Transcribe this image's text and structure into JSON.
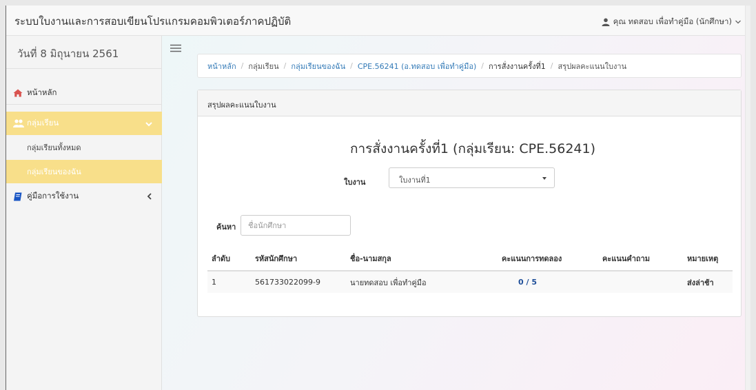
{
  "header": {
    "title": "ระบบใบงานและการสอบเขียนโปรแกรมคอมพิวเตอร์ภาคปฏิบัติ",
    "user": "คุณ ทดสอบ เพื่อทำคู่มือ (นักศึกษา)",
    "user_icon": "user-icon",
    "dropdown_icon": "caret-down-icon"
  },
  "sidebar": {
    "date": "วันที่ 8 มิถุนายน 2561",
    "items": [
      {
        "label": "หน้าหลัก",
        "icon": "home-icon"
      },
      {
        "label": "กลุ่มเรียน",
        "icon": "users-icon"
      },
      {
        "label": "กลุ่มเรียนทั้งหมด"
      },
      {
        "label": "กลุ่มเรียนของฉัน"
      },
      {
        "label": "คู่มือการใช้งาน",
        "icon": "book-icon"
      }
    ]
  },
  "breadcrumb": {
    "items": [
      "หน้าหลัก",
      "กลุ่มเรียน",
      "กลุ่มเรียนของฉัน",
      "CPE.56241 (อ.ทดสอบ เพื่อทำคู่มือ)",
      "การสั่งงานครั้งที่1",
      "สรุปผลคะแนนใบงาน"
    ]
  },
  "panel": {
    "heading": "สรุปผลคะแนนใบงาน",
    "title": "การสั่งงานครั้งที่1 (กลุ่มเรียน: CPE.56241)",
    "sheet_label": "ใบงาน",
    "sheet_selected": "ใบงานที่1",
    "search_label": "ค้นหา",
    "search_placeholder": "ชื่อนักศึกษา"
  },
  "table": {
    "headers": [
      "ลำดับ",
      "รหัสนักศึกษา",
      "ชื่อ-นามสกุล",
      "คะแนนการทดลอง",
      "คะแนนคำถาม",
      "หมายเหตุ"
    ],
    "rows": [
      {
        "no": "1",
        "student_id": "561733022099-9",
        "name": "นายทดสอบ เพื่อทำคู่มือ",
        "lab_score": "0",
        "lab_total": "5",
        "question_score": "",
        "remark": "ส่งล่าช้า"
      }
    ]
  },
  "colors": {
    "accent_yellow": "#f8df8a",
    "link_blue": "#337ab7",
    "late_red": "#e00000",
    "home_red": "#d9534f",
    "book_blue": "#1a56c4"
  }
}
